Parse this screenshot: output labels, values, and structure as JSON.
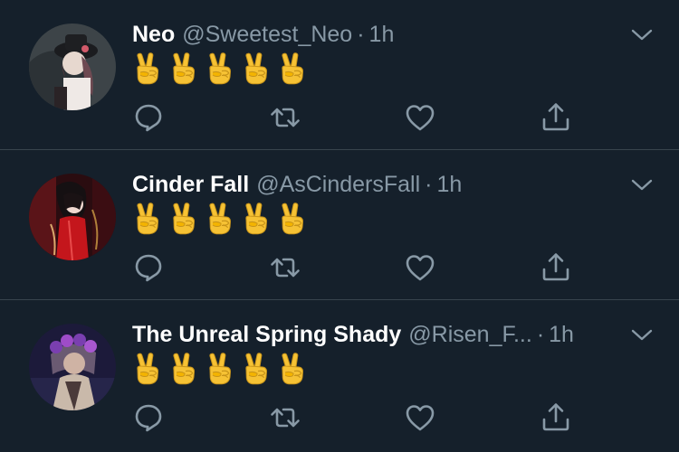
{
  "colors": {
    "background": "#15202b",
    "divider": "#38444d",
    "name_text": "#ffffff",
    "secondary_text": "#8899a6",
    "emoji_yellow": "#f6c234"
  },
  "tweets": [
    {
      "name": "Neo",
      "handle": "@Sweetest_Neo",
      "separator": "·",
      "time": "1h",
      "emojis": [
        "✌️",
        "✌️",
        "✌️",
        "✌️",
        "✌️"
      ],
      "avatar": "avatar-neo",
      "actions": [
        "reply-icon",
        "retweet-icon",
        "like-icon",
        "share-icon"
      ]
    },
    {
      "name": "Cinder Fall",
      "handle": "@AsCindersFall",
      "separator": "·",
      "time": "1h",
      "emojis": [
        "✌️",
        "✌️",
        "✌️",
        "✌️",
        "✌️"
      ],
      "avatar": "avatar-cinder",
      "actions": [
        "reply-icon",
        "retweet-icon",
        "like-icon",
        "share-icon"
      ]
    },
    {
      "name": "The Unreal Spring Shady",
      "handle": "@Risen_F...",
      "separator": "·",
      "time": "1h",
      "emojis": [
        "✌️",
        "✌️",
        "✌️",
        "✌️",
        "✌️"
      ],
      "avatar": "avatar-spring",
      "actions": [
        "reply-icon",
        "retweet-icon",
        "like-icon",
        "share-icon"
      ]
    }
  ]
}
